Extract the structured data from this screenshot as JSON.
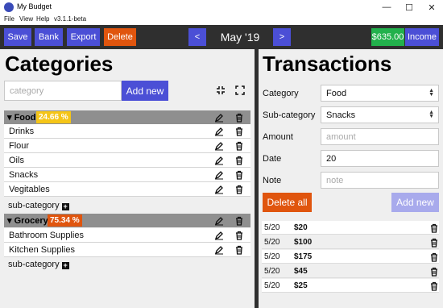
{
  "window": {
    "title": "My Budget",
    "minimize": "—",
    "maximize": "☐",
    "close": "✕"
  },
  "menu": {
    "file": "File",
    "view": "View",
    "help": "Help",
    "version": "v3.1.1-beta"
  },
  "toolbar": {
    "save": "Save",
    "bank": "Bank",
    "export": "Export",
    "delete": "Delete",
    "prev": "<",
    "month": "May '19",
    "next": ">",
    "balance": "$635.00",
    "income": "Income"
  },
  "categories": {
    "title": "Categories",
    "placeholder": "category",
    "add_new": "Add new",
    "groups": [
      {
        "name": "Food",
        "percent": "24.66 %",
        "badge_color": "#f5c518",
        "items": [
          "Drinks",
          "Flour",
          "Oils",
          "Snacks",
          "Vegitables"
        ]
      },
      {
        "name": "Grocery",
        "percent": "75.34 %",
        "badge_color": "#e0550e",
        "items": [
          "Bathroom Supplies",
          "Kitchen Supplies"
        ]
      }
    ],
    "subcategory_label": "sub-category"
  },
  "transactions": {
    "title": "Transactions",
    "labels": {
      "category": "Category",
      "subcategory": "Sub-category",
      "amount": "Amount",
      "date": "Date",
      "note": "Note"
    },
    "category_value": "Food",
    "subcategory_value": "Snacks",
    "amount_placeholder": "amount",
    "date_value": "20",
    "note_placeholder": "note",
    "delete_all": "Delete all",
    "add_new": "Add new",
    "rows": [
      {
        "date": "5/20",
        "amount": "$20"
      },
      {
        "date": "5/20",
        "amount": "$100"
      },
      {
        "date": "5/20",
        "amount": "$175"
      },
      {
        "date": "5/20",
        "amount": "$45"
      },
      {
        "date": "5/20",
        "amount": "$25"
      }
    ]
  },
  "colors": {
    "accent": "#4b4fd6",
    "danger": "#e0550e",
    "success": "#22b14c",
    "dark": "#2f2f2f"
  }
}
